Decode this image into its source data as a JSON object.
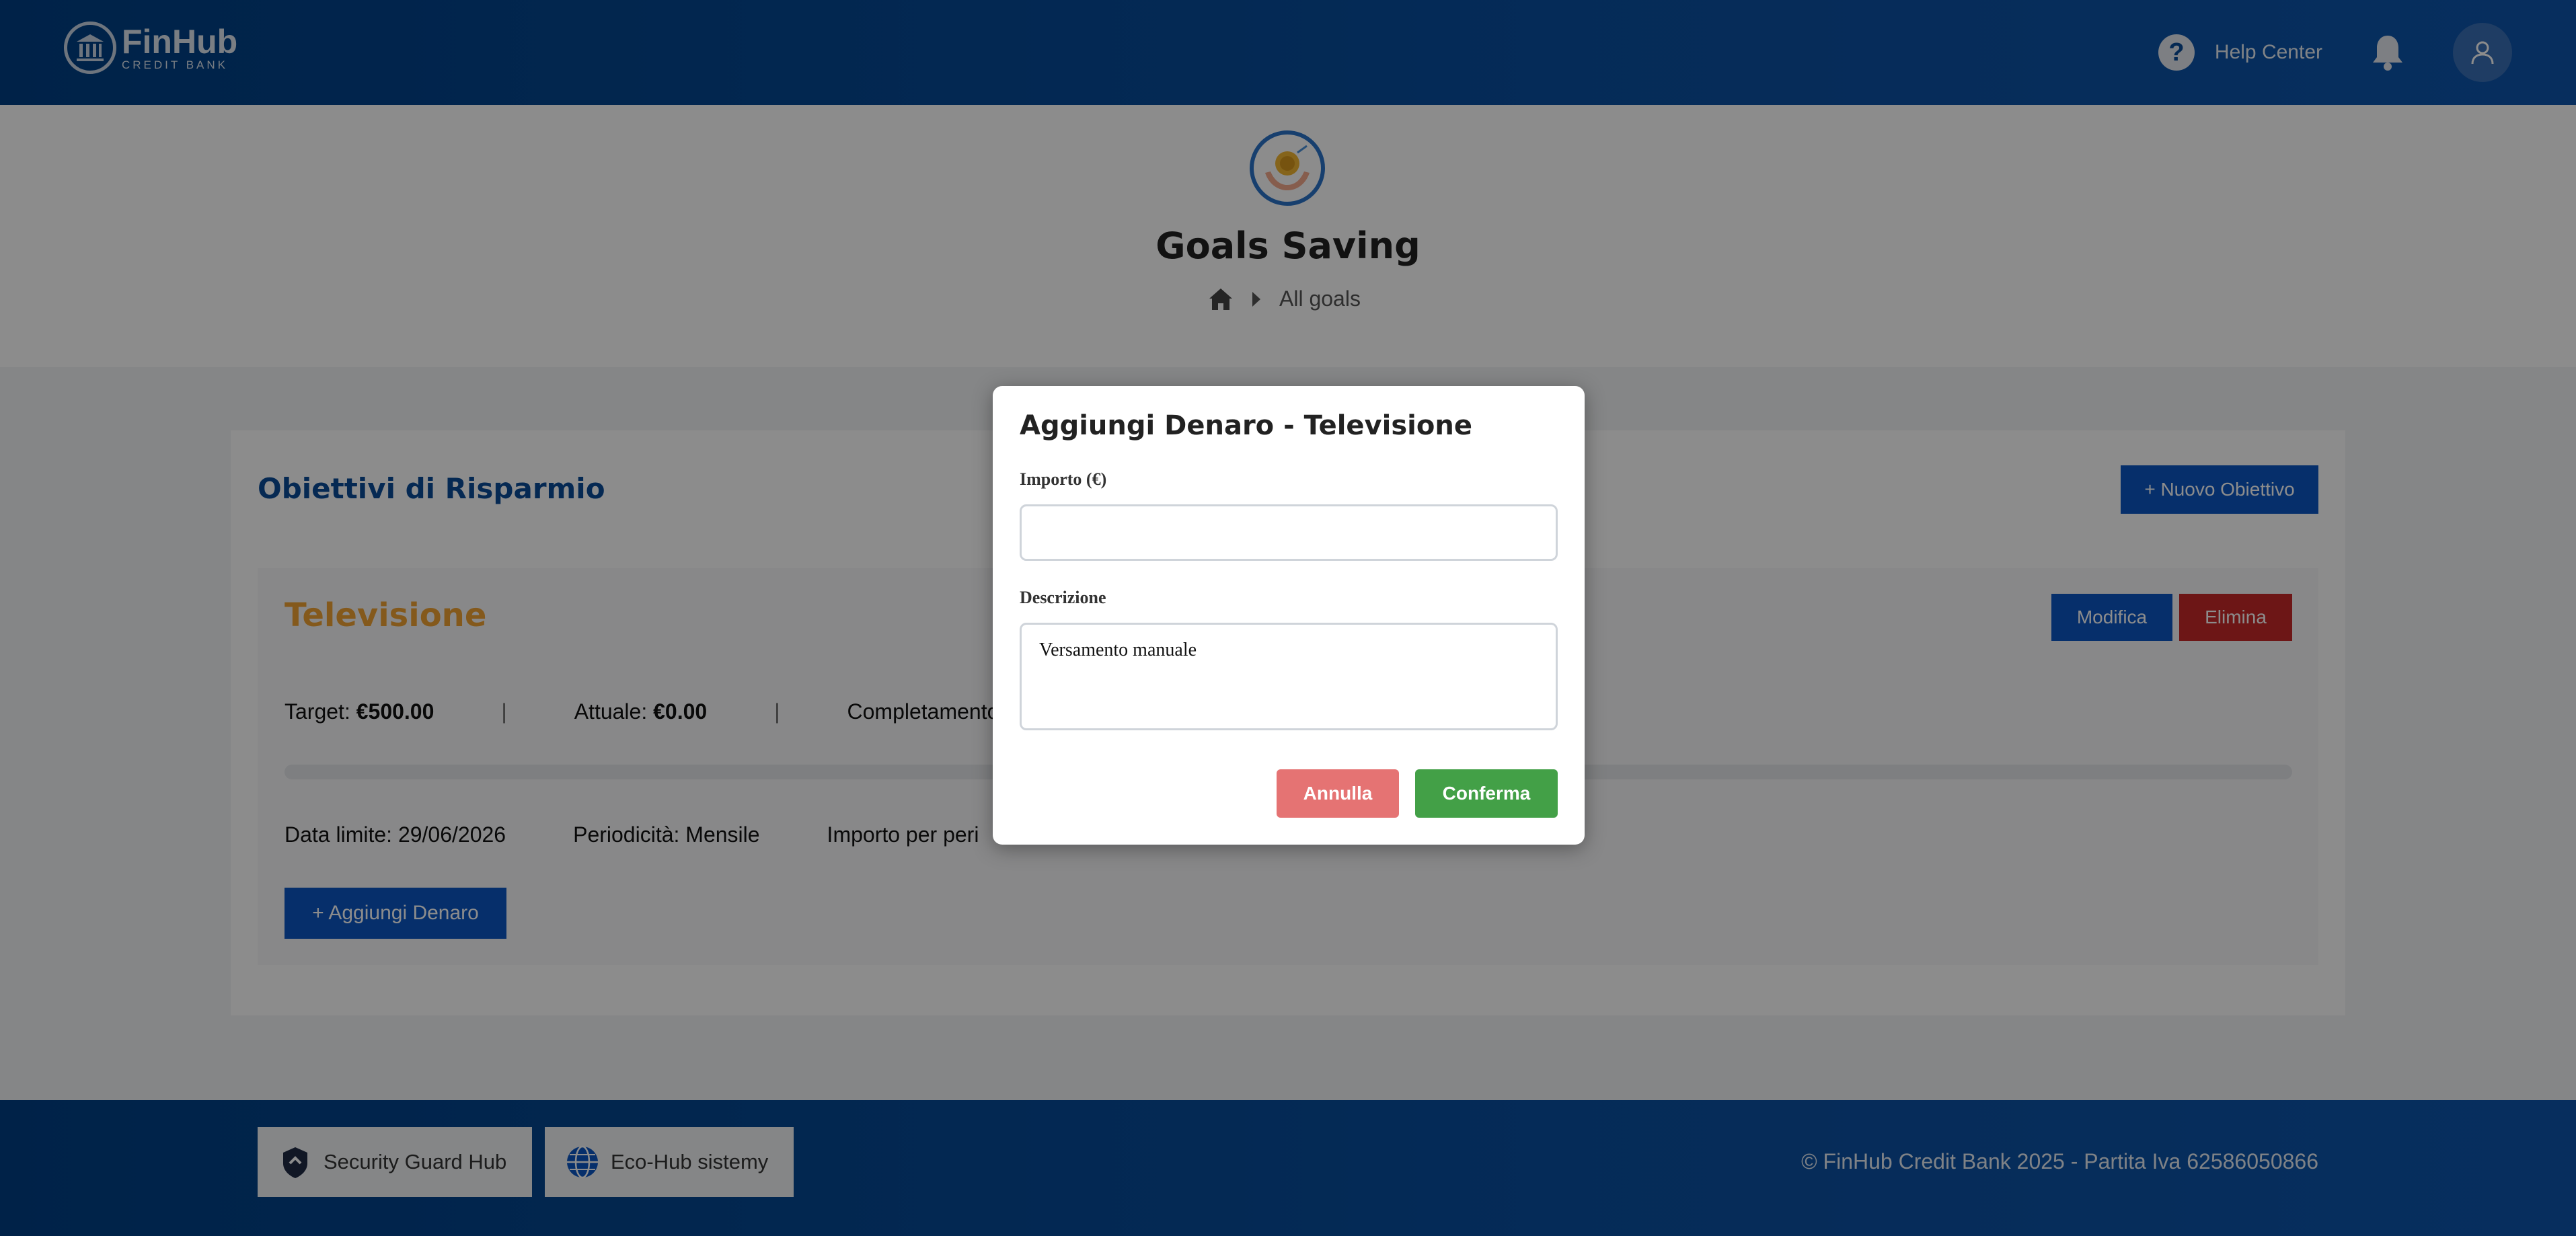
{
  "header": {
    "brand_name": "FinHub",
    "brand_sub": "CREDIT BANK",
    "help_label": "Help Center",
    "icons": {
      "help": "question-circle-icon",
      "bell": "bell-icon",
      "avatar": "user-icon"
    }
  },
  "hero": {
    "title": "Goals Saving",
    "breadcrumb": {
      "current": "All goals"
    }
  },
  "main": {
    "section_title": "Obiettivi di Risparmio",
    "new_goal_button": "+ Nuovo Obiettivo",
    "goal": {
      "title": "Televisione",
      "edit_button": "Modifica",
      "delete_button": "Elimina",
      "target_label": "Target:",
      "target_value": "€500.00",
      "current_label": "Attuale:",
      "current_value": "€0.00",
      "separator": "|",
      "completion_label": "Completamento",
      "progress": 0,
      "deadline": "Data limite: 29/06/2026",
      "periodicity": "Periodicità: Mensile",
      "period_amount": "Importo per peri",
      "add_money_button": "+ Aggiungi Denaro"
    }
  },
  "footer": {
    "partners": [
      {
        "label": "Security Guard Hub",
        "icon": "shield-logo-icon"
      },
      {
        "label": "Eco-Hub sistemy",
        "icon": "globe-icon"
      }
    ],
    "copyright": "© FinHub Credit Bank 2025 - Partita Iva 62586050866"
  },
  "modal": {
    "title": "Aggiungi Denaro - Televisione",
    "amount_label": "Importo (€)",
    "amount_value": "",
    "description_label": "Descrizione",
    "description_value": "Versamento manuale",
    "cancel_button": "Annulla",
    "confirm_button": "Conferma"
  },
  "colors": {
    "primary": "#0b57c4",
    "goal_title": "#f0a233",
    "danger": "#c62828",
    "cancel": "#e57373",
    "confirm": "#43a047"
  }
}
